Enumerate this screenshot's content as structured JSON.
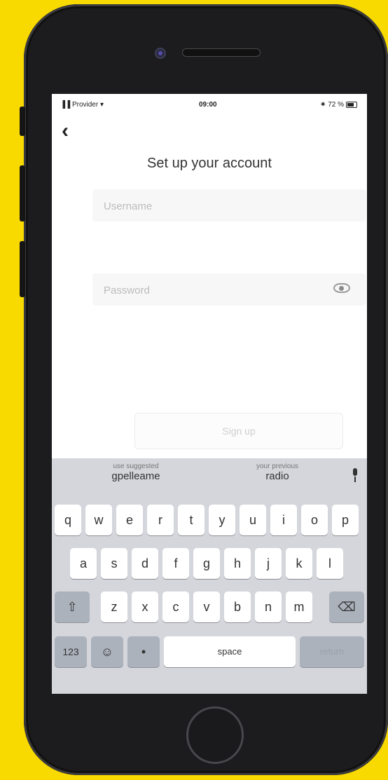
{
  "status_bar": {
    "carrier": "▐▐ Provider ▾",
    "time": "09:00",
    "battery": "✷ 72 %"
  },
  "nav": {
    "back_icon": "‹"
  },
  "screen_title": "Set up your account",
  "form": {
    "username_placeholder": "Username",
    "password_placeholder": "Password",
    "signup_label": "Sign up"
  },
  "keyboard": {
    "suggestions": [
      {
        "hint": "use suggested",
        "word": "gpelleame"
      },
      {
        "hint": "your previous",
        "word": "radio"
      }
    ],
    "row1": [
      "q",
      "w",
      "e",
      "r",
      "t",
      "y",
      "u",
      "i",
      "o",
      "p"
    ],
    "row2": [
      "a",
      "s",
      "d",
      "f",
      "g",
      "h",
      "j",
      "k",
      "l"
    ],
    "row3": [
      "z",
      "x",
      "c",
      "v",
      "b",
      "n",
      "m"
    ],
    "shift_icon": "⇧",
    "delete_icon": "⌫",
    "numbers_label": "123",
    "emoji_icon": "☺",
    "mic_icon": "•",
    "space_label": "space",
    "return_label": "return"
  }
}
